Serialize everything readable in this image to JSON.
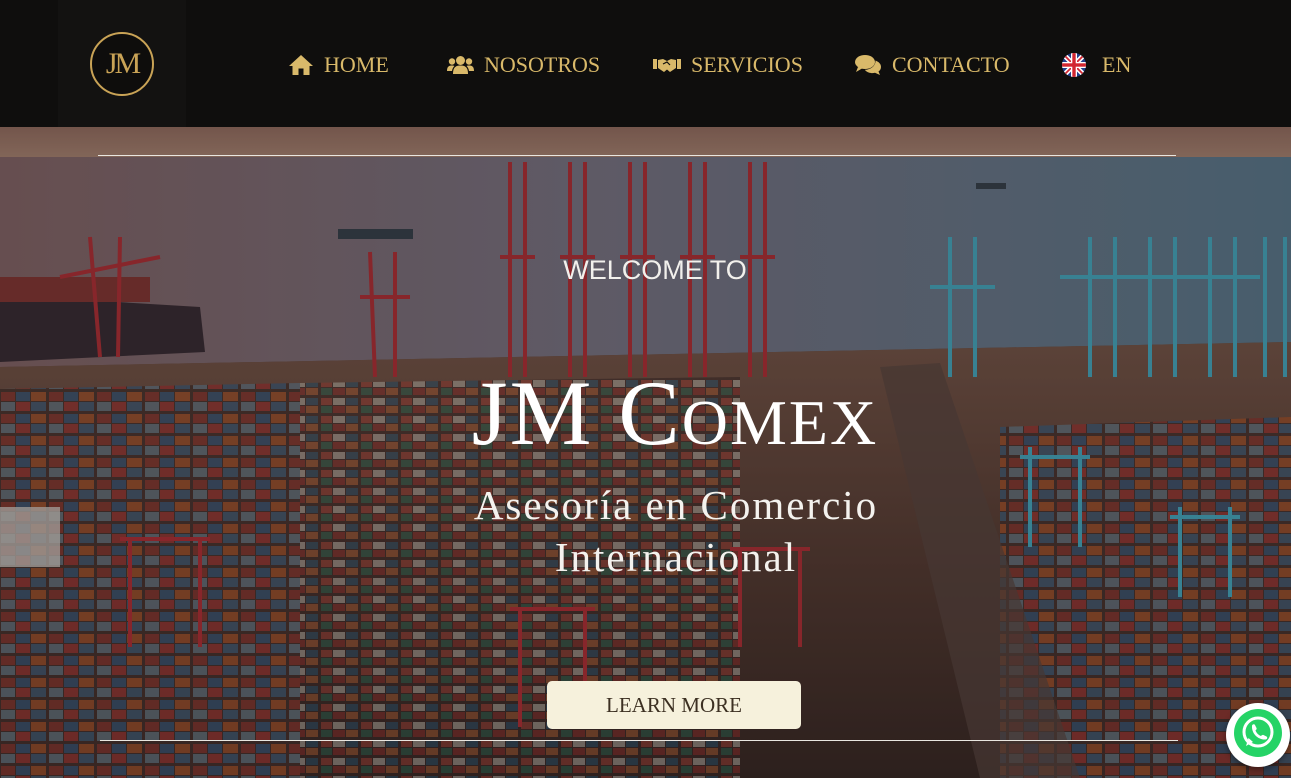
{
  "logo": {
    "text": "JM"
  },
  "nav": {
    "home": {
      "label": "HOME",
      "icon": "home-icon"
    },
    "nosotros": {
      "label": "NOSOTROS",
      "icon": "users-icon"
    },
    "servicios": {
      "label": "SERVICIOS",
      "icon": "handshake-icon"
    },
    "contacto": {
      "label": "CONTACTO",
      "icon": "comments-icon"
    },
    "language": {
      "label": "EN",
      "icon": "uk-flag-icon"
    }
  },
  "hero": {
    "welcome": "WELCOME TO",
    "title": "JM Comex",
    "subtitle": "Asesoría en Comercio Internacional",
    "cta_label": "LEARN MORE"
  },
  "floating": {
    "whatsapp_icon": "whatsapp-icon"
  },
  "colors": {
    "nav_background": "#0f0e0d",
    "gold_accent": "#d9b96a",
    "cta_background": "#f6f1dc",
    "whatsapp_green": "#25d366"
  }
}
